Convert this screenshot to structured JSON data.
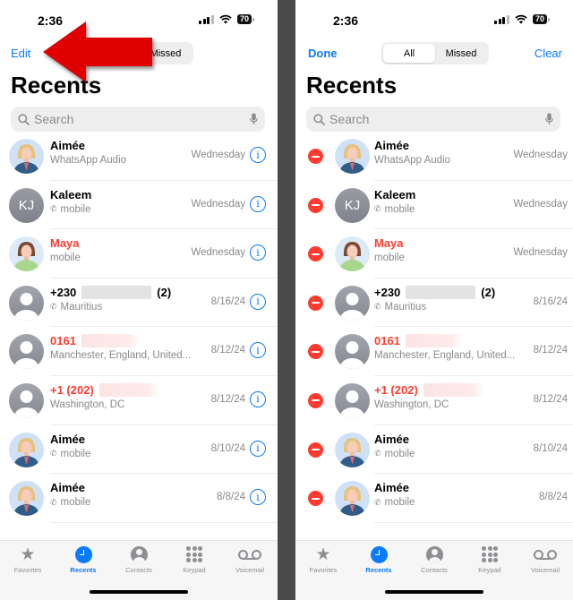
{
  "status": {
    "time": "2:36",
    "battery": "70"
  },
  "left": {
    "edit_label": "Edit",
    "segments": [
      "All",
      "Missed"
    ],
    "active_segment": "All"
  },
  "right": {
    "done_label": "Done",
    "clear_label": "Clear",
    "segments": [
      "All",
      "Missed"
    ],
    "active_segment": "All"
  },
  "title": "Recents",
  "search": {
    "placeholder": "Search"
  },
  "calls": [
    {
      "name": "Aimée",
      "sub": "WhatsApp Audio",
      "date": "Wednesday",
      "missed": false,
      "avatar": "photo-woman-blonde",
      "phone_icon": false
    },
    {
      "name": "Kaleem",
      "sub": "mobile",
      "date": "Wednesday",
      "missed": false,
      "avatar": "initials",
      "initials": "KJ",
      "phone_icon": true
    },
    {
      "name": "Maya",
      "sub": "mobile",
      "date": "Wednesday",
      "missed": true,
      "avatar": "photo-woman-brunette",
      "phone_icon": false
    },
    {
      "name": "+230",
      "name_suffix": "(2)",
      "redacted": true,
      "sub": "Mauritius",
      "date": "8/16/24",
      "missed": false,
      "avatar": "generic",
      "phone_icon": true
    },
    {
      "name": "0161",
      "redacted": true,
      "sub": "Manchester, England, United...",
      "date": "8/12/24",
      "missed": true,
      "avatar": "generic",
      "phone_icon": false
    },
    {
      "name": "+1 (202)",
      "redacted": true,
      "sub": "Washington, DC",
      "date": "8/12/24",
      "missed": true,
      "avatar": "generic",
      "phone_icon": false
    },
    {
      "name": "Aimée",
      "sub": "mobile",
      "date": "8/10/24",
      "missed": false,
      "avatar": "photo-woman-blonde",
      "phone_icon": true
    },
    {
      "name": "Aimée",
      "sub": "mobile",
      "date": "8/8/24",
      "missed": false,
      "avatar": "photo-woman-blonde",
      "phone_icon": true
    }
  ],
  "tabs": [
    {
      "label": "Favorites",
      "icon": "star-icon",
      "active": false
    },
    {
      "label": "Recents",
      "icon": "clock-icon",
      "active": true
    },
    {
      "label": "Contacts",
      "icon": "contact-icon",
      "active": false
    },
    {
      "label": "Keypad",
      "icon": "keypad-icon",
      "active": false
    },
    {
      "label": "Voicemail",
      "icon": "voicemail-icon",
      "active": false
    }
  ],
  "annotation": {
    "type": "red-arrow",
    "points_to": "Edit"
  },
  "colors": {
    "accent": "#0a7aff",
    "missed": "#ff3b30",
    "delete": "#ff3b30",
    "arrow": "#e00000"
  }
}
